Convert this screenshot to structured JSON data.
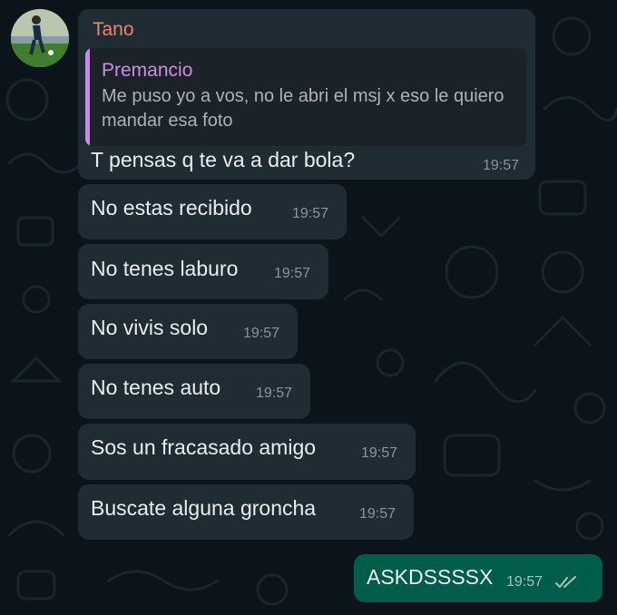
{
  "chat": {
    "messages": [
      {
        "sender": "Tano",
        "quoted": {
          "author": "Premancio",
          "text": "Me puso yo a vos, no le abri el msj x eso le quiero mandar esa foto"
        },
        "text": "T pensas q te va a dar bola?",
        "time": "19:57"
      },
      {
        "text": "No estas recibido",
        "time": "19:57"
      },
      {
        "text": "No tenes laburo",
        "time": "19:57"
      },
      {
        "text": "No vivis solo",
        "time": "19:57"
      },
      {
        "text": "No tenes auto",
        "time": "19:57"
      },
      {
        "text": "Sos un fracasado amigo",
        "time": "19:57"
      },
      {
        "text": "Buscate alguna groncha",
        "time": "19:57"
      }
    ],
    "outgoing": {
      "text": "ASKDSSSSX",
      "time": "19:57",
      "status_icon": "double-check-icon"
    }
  },
  "colors": {
    "background": "#0b141a",
    "incoming_bubble": "#1f2c33",
    "outgoing_bubble": "#005c4b",
    "sender_name": "#f2836b",
    "quote_accent": "#c98de0"
  }
}
